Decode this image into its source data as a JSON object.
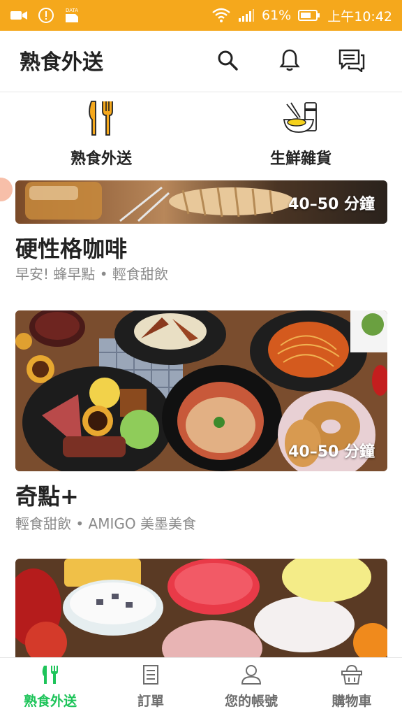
{
  "status_bar": {
    "data_label": "DATA",
    "battery": "61%",
    "time": "上午10:42",
    "color": "#f5a81c"
  },
  "header": {
    "title": "熟食外送",
    "icons": [
      "search-icon",
      "bell-icon",
      "chat-icon"
    ]
  },
  "categories": [
    {
      "label": "熟食外送",
      "icon": "utensils-icon"
    },
    {
      "label": "生鮮雜貨",
      "icon": "grocery-icon"
    }
  ],
  "stores": [
    {
      "eta": "40–50 分鐘",
      "name": "硬性格咖啡",
      "tags": "早安! 蜂早點 • 輕食甜飲"
    },
    {
      "eta": "40–50 分鐘",
      "name": "奇點+",
      "tags": "輕食甜飲 • AMIGO 美墨美食"
    },
    {
      "eta": "",
      "name": "",
      "tags": ""
    }
  ],
  "bottom_nav": [
    {
      "label": "熟食外送",
      "icon": "utensils-icon",
      "active": true
    },
    {
      "label": "訂單",
      "icon": "receipt-icon",
      "active": false
    },
    {
      "label": "您的帳號",
      "icon": "user-icon",
      "active": false
    },
    {
      "label": "購物車",
      "icon": "basket-icon",
      "active": false
    }
  ],
  "accent_color": "#1ec45a"
}
